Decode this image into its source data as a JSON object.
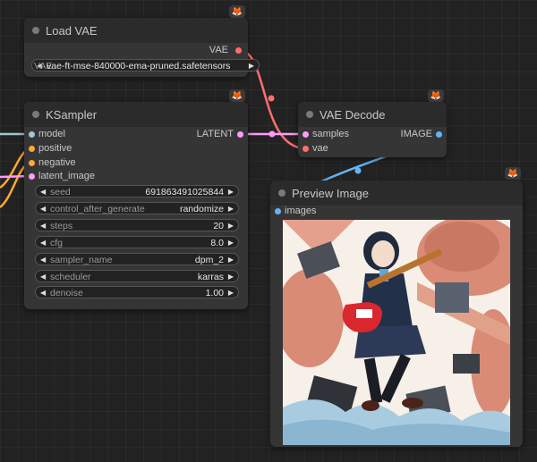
{
  "nodes": {
    "load_vae": {
      "title": "Load VAE",
      "output_label": "VAE",
      "widget_name": "VAE",
      "widget_value": "vae-ft-mse-840000-ema-pruned.safetensors"
    },
    "ksampler": {
      "title": "KSampler",
      "inputs": [
        "model",
        "positive",
        "negative",
        "latent_image"
      ],
      "output_label": "LATENT",
      "widgets": [
        {
          "name": "seed",
          "value": "691863491025844"
        },
        {
          "name": "control_after_generate",
          "value": "randomize"
        },
        {
          "name": "steps",
          "value": "20"
        },
        {
          "name": "cfg",
          "value": "8.0"
        },
        {
          "name": "sampler_name",
          "value": "dpm_2"
        },
        {
          "name": "scheduler",
          "value": "karras"
        },
        {
          "name": "denoise",
          "value": "1.00"
        }
      ]
    },
    "vae_decode": {
      "title": "VAE Decode",
      "inputs": [
        "samples",
        "vae"
      ],
      "output_label": "IMAGE"
    },
    "preview_image": {
      "title": "Preview Image",
      "inputs": [
        "images"
      ]
    }
  },
  "colors": {
    "canvas": "#222222",
    "node_body": "#353535",
    "node_header": "#2b2b2b",
    "link_vae": "#ff6e6e",
    "link_latent": "#ff9cf9",
    "link_image": "#64b5f6",
    "link_cond": "#ffa931",
    "badge": "#f29a2e"
  },
  "icons": {
    "badge": "fox-badge-icon",
    "left_arrow": "triangle-left-icon",
    "right_arrow": "triangle-right-icon"
  }
}
